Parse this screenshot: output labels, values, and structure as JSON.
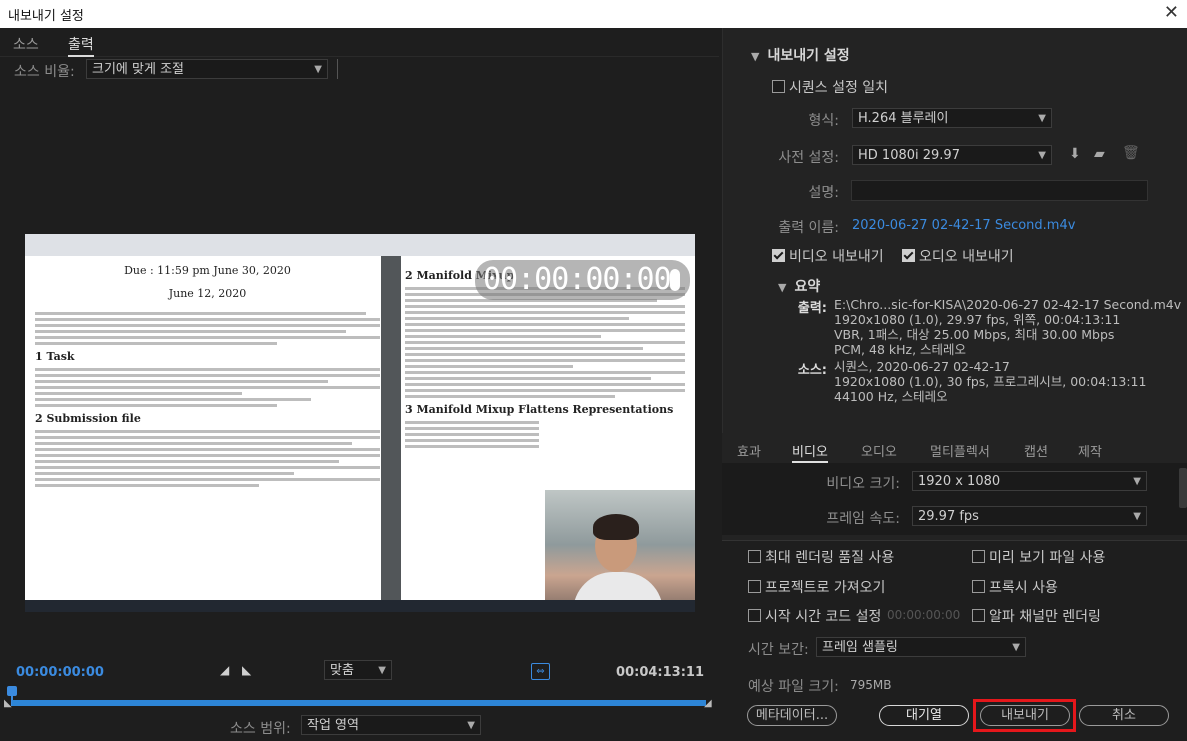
{
  "window": {
    "title": "내보내기 설정",
    "close": "✕"
  },
  "left": {
    "tabs": [
      "소스",
      "출력"
    ],
    "source_ratio_label": "소스 비율:",
    "source_ratio_value": "크기에 맞게 조절",
    "preview": {
      "doc_title": "Due : 11:59 pm June 30, 2020",
      "doc_date": "June 12, 2020",
      "heading_task": "1   Task",
      "heading_submit": "2   Submission file",
      "heading_mixup": "2   Manifold Mixup",
      "heading_flatten": "3   Manifold Mixup Flattens Representations",
      "timer": "00:00:00:00"
    },
    "timeline": {
      "current": "00:00:00:00",
      "end": "00:04:13:11",
      "fit_label": "맞춤",
      "range_label": "소스 범위:",
      "range_value": "작업 영역"
    }
  },
  "right": {
    "export_settings": {
      "title": "내보내기 설정",
      "match_sequence": "시퀀스 설정 일치",
      "format_label": "형식:",
      "format_value": "H.264 블루레이",
      "preset_label": "사전 설정:",
      "preset_value": "HD 1080i 29.97",
      "comment_label": "설명:",
      "output_name_label": "출력 이름:",
      "output_name_value": "2020-06-27 02-42-17 Second.m4v",
      "export_video": "비디오 내보내기",
      "export_audio": "오디오 내보내기"
    },
    "summary": {
      "title": "요약",
      "output_label": "출력:",
      "output_value": "E:\\Chro...sic-for-KISA\\2020-06-27 02-42-17 Second.m4v\n1920x1080 (1.0), 29.97 fps, 위쪽, 00:04:13:11\nVBR, 1패스, 대상 25.00 Mbps, 최대 30.00 Mbps\nPCM, 48 kHz, 스테레오",
      "source_label": "소스:",
      "source_value": "시퀀스, 2020-06-27 02-42-17\n1920x1080 (1.0), 30 fps, 프로그레시브, 00:04:13:11\n44100 Hz, 스테레오"
    },
    "subtabs": [
      "효과",
      "비디오",
      "오디오",
      "멀티플렉서",
      "캡션",
      "제작"
    ],
    "video": {
      "size_label": "비디오 크기:",
      "size_value": "1920 x 1080",
      "fps_label": "프레임 속도:",
      "fps_value": "29.97 fps"
    },
    "options": {
      "max_render": "최대 렌더링 품질 사용",
      "use_preview": "미리 보기 파일 사용",
      "import_project": "프로젝트로 가져오기",
      "use_proxy": "프록시 사용",
      "start_timecode": "시작 시간 코드 설정",
      "start_timecode_value": "00:00:00:00",
      "alpha_only": "알파 채널만 렌더링",
      "time_interp_label": "시간 보간:",
      "time_interp_value": "프레임 샘플링",
      "est_size_label": "예상 파일 크기:",
      "est_size_value": "795MB"
    },
    "buttons": {
      "metadata": "메타데이터...",
      "queue": "대기열",
      "export": "내보내기",
      "cancel": "취소"
    }
  }
}
